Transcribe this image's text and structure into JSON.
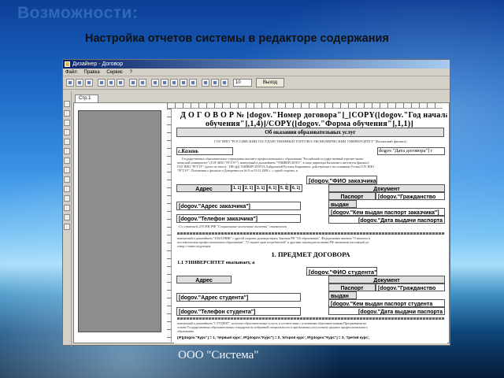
{
  "slide": {
    "title": "Возможности:",
    "subtitle": "Настройка отчетов системы в редакторе содержания",
    "footer": "ООО \"Система\""
  },
  "app": {
    "window_title": "Дизайнер - Договор",
    "menu": [
      "Файл",
      "Правка",
      "Сервис",
      "?"
    ],
    "select_value": "10",
    "exit_label": "Выход",
    "tab_label": "Стр.1"
  },
  "document": {
    "heading": "Д О Г О В О Р   № [dogov.\"Номер договора\"]_[COPY([dogov.\"Год начала обучения\"],1,4)]/COPY([dogov.\"Форма обучения\"],1,1)]",
    "heading_line1": "Д О Г О В О Р   № [dogov.\"Номер договора\"]_[COPY([dogov.\"Год начала",
    "heading_line2": "обучения\"],1,4)]/COPY([dogov.\"Форма обучения\"],1,1)]",
    "subject_title": "Об оказании образовательных услуг",
    "university_name": "ГОУ ВПО \"РОССИЙСКИЙ ГОСУДАРСТВЕННЫЙ ТОРГОВО-ЭКОНОМИЧЕСКИЙ УНИВЕРСИТЕТ\" (Казанский филиал)",
    "city": "г.Казань",
    "contract_date": "dogov.\"Дата договора\"] г",
    "preamble": [
      "Государственное образовательное учреждение высшего профессионального образования \"Российский государственный торгово-эконо-",
      "мический университет\" (ГОУ ВПО \"РГТЭУ\"), именуемый в дальнейшем \"УНИВЕРСИТЕТ\", в лице директора Казанского института (филиал)",
      "ГОУ ВПО \"РГТЭУ\" (далее по тексту - ПИ (ф)) УНИВЕРСИТЕТА Хайрулиной Рустама Баярчевича, действующего на основании Устава ГОУ ВПО",
      "\"РГТЭУ\", Положения о филиале и Доверенности № 8 от 01.01.2008 г., с одной стороны, и"
    ],
    "customer_fio": "[dogov.\"ФИО заказчика\"]",
    "address_label": "Адрес",
    "address_parts": [
      "1, 1]",
      "2, 1]",
      "3, 1]",
      "4, 1]",
      "5, 1]",
      "6, 1]"
    ],
    "doc_label": "Документ",
    "passport_label": "Паспорт",
    "citizenship": "[dogov.\"Гражданство",
    "issued_label": "выдан",
    "customer_address": "[dogov.\"Адрес заказчика\"]",
    "customer_issuer": "[dogov.\"Кем выдан паспорт заказчика\"]",
    "customer_issue_date": "[dogov.\"Дата выдачи паспорта",
    "customer_phone": "[dogov.\"Телефон заказчика\"]",
    "consent_note": "Со статьей 233 НК РФ \"Социальные налоговые вычеты\" ознакомлен",
    "mid_text": [
      "именуемый в дальнейшем \"ЗАКАЗЧИК\" с другой стороны, руководствуясь Законом РФ \"Об образовании\", Федеральным законом \"О высшем и",
      "послевузовском профессиональном образовании\", \"О защите прав потребителей\" и другими законодательствами РФ заключили настоящий до-",
      "говор о нижеследующем:"
    ],
    "section1_title": "1. ПРЕДМЕТ ДОГОВОРА",
    "clause_1_1": "1.1 УНИВЕРСИТЕТ оказывает, а",
    "student_fio": "[dogov.\"ФИО студента\"]",
    "student_address": "[dogov.\"Адрес студента\"]",
    "student_issuer": "[dogov.\"Кем выдан паспорт студента",
    "student_issue_date": "[dogov.\"Дата выдачи паспорта",
    "student_phone": "[dogov.\"Телефон студента\"]",
    "bottom_text": [
      "именуемый в дальнейшем \"СТУДЕНТ\", получает образовательные услуги, в соответствии с основными образовательными Программами на",
      "основе Государственных образовательных стандартов по избранной специальности и при наличии (отсутствии) среднего профессионального",
      "образования"
    ],
    "course_formula": "[IF([dogov.\"Курс\"] = 1, 'первый курс', IF([dogov.\"Курс\"] = 2, 'второй курс', IF([dogov.\"Курс\"] = 3, 'третий курс',"
  }
}
